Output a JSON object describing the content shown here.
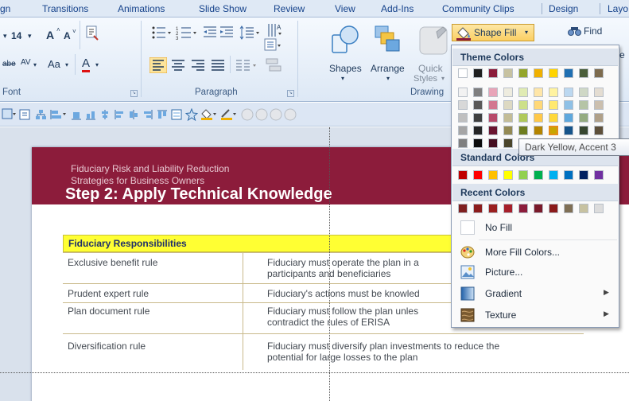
{
  "tabs": [
    "gn",
    "Transitions",
    "Animations",
    "Slide Show",
    "Review",
    "View",
    "Add-Ins",
    "Community Clips",
    "Design",
    "Layo"
  ],
  "ribbon": {
    "font_size": "14",
    "grow_font": "A",
    "shrink_font": "A",
    "strikethrough": "abe",
    "char_spacing": "AV",
    "change_case": "Aa",
    "font_color": "A",
    "font_group_label": "Font",
    "paragraph_group_label": "Paragraph",
    "drawing_group_label": "Drawing",
    "shapes_label": "Shapes",
    "arrange_label": "Arrange",
    "quick_label": "Quick",
    "styles_label": "Styles",
    "shape_fill_label": "Shape Fill",
    "find_label": "Find",
    "edge_letter": "e"
  },
  "slide": {
    "subtitle_line1": "Fiduciary Risk and Liability Reduction",
    "subtitle_line2": "Strategies for Business Owners",
    "title": "Step 2: Apply Technical Knowledge",
    "table_header": "Fiduciary  Responsibilities",
    "rows": [
      {
        "rule": "Exclusive benefit rule",
        "desc": [
          "Fiduciary must operate the plan in a",
          "participants and beneficiaries"
        ]
      },
      {
        "rule": "Prudent expert rule",
        "desc": [
          "Fiduciary's actions must be knowled"
        ]
      },
      {
        "rule": "Plan document rule",
        "desc": [
          "Fiduciary must follow the plan unles",
          "contradict the rules of ERISA"
        ]
      },
      {
        "rule": "Diversification rule",
        "desc": [
          "Fiduciary must diversify plan investments to reduce the",
          "potential for large losses to the plan"
        ]
      }
    ]
  },
  "menu": {
    "theme_colors_label": "Theme Colors",
    "standard_colors_label": "Standard Colors",
    "recent_colors_label": "Recent Colors",
    "no_fill": "No Fill",
    "more_fill_colors": "More Fill Colors...",
    "picture": "Picture...",
    "gradient": "Gradient",
    "texture": "Texture",
    "tooltip": "Dark Yellow, Accent 3",
    "theme_grid": [
      [
        "#ffffff",
        "#1f1f1f",
        "#8c1c3b",
        "#c7c2a1",
        "#94a52a",
        "#f0b000",
        "#ffd400",
        "#1f6fb2",
        "#4a5e3a",
        "#7d6b4e"
      ],
      [
        "#f2f2f2",
        "#7f7f7f",
        "#e8a4b8",
        "#eeecdf",
        "#e0ebb3",
        "#ffe6a8",
        "#fff3a0",
        "#bcd8f0",
        "#cfd8c6",
        "#e4ddd2"
      ],
      [
        "#d8d8d8",
        "#595959",
        "#d27790",
        "#ddd9c2",
        "#cde08a",
        "#ffd878",
        "#ffe970",
        "#8ec0e6",
        "#b5c4a6",
        "#cbbfae"
      ],
      [
        "#bfbfbf",
        "#3f3f3f",
        "#b84a6a",
        "#c4bd97",
        "#b0c95a",
        "#ffc848",
        "#ffd838",
        "#5ea8dd",
        "#94ab80",
        "#b0a088"
      ],
      [
        "#a5a5a5",
        "#262626",
        "#6a1530",
        "#948a54",
        "#6e7d20",
        "#b48400",
        "#c8a600",
        "#16548a",
        "#374730",
        "#5e503a"
      ],
      [
        "#7f7f7f",
        "#0c0c0c",
        "#460e20",
        "#4a452a",
        "#4a5315",
        "#785800",
        "#8a7200",
        "#0f385c",
        "#252f20",
        "#3f3527"
      ]
    ],
    "standard_colors": [
      "#c00000",
      "#ff0000",
      "#ffc000",
      "#ffff00",
      "#92d050",
      "#00b050",
      "#00b0f0",
      "#0070c0",
      "#002060",
      "#7030a0"
    ],
    "recent_colors": [
      "#7f1f1f",
      "#8c1c1c",
      "#9a1f1f",
      "#a61f2a",
      "#8c1c3b",
      "#7a1a2a",
      "#8a1a1a",
      "#7f6f55",
      "#c7c2a1",
      "#dcdcdc"
    ],
    "selected_theme_cell": [
      4,
      6
    ]
  },
  "colors": {
    "slide_band": "#8c1c3b",
    "table_header": "#ffff33",
    "ribbon_bg": "#dde8f5"
  },
  "icons": [
    "paste-icon",
    "bullets-icon",
    "numbering-icon",
    "align-left-icon",
    "center-icon",
    "align-right-icon",
    "justify-icon",
    "shapes-icon",
    "arrange-icon",
    "quick-styles-icon",
    "shape-fill-icon",
    "find-icon",
    "eyedropper-icon",
    "picture-icon",
    "gradient-icon",
    "texture-icon"
  ]
}
